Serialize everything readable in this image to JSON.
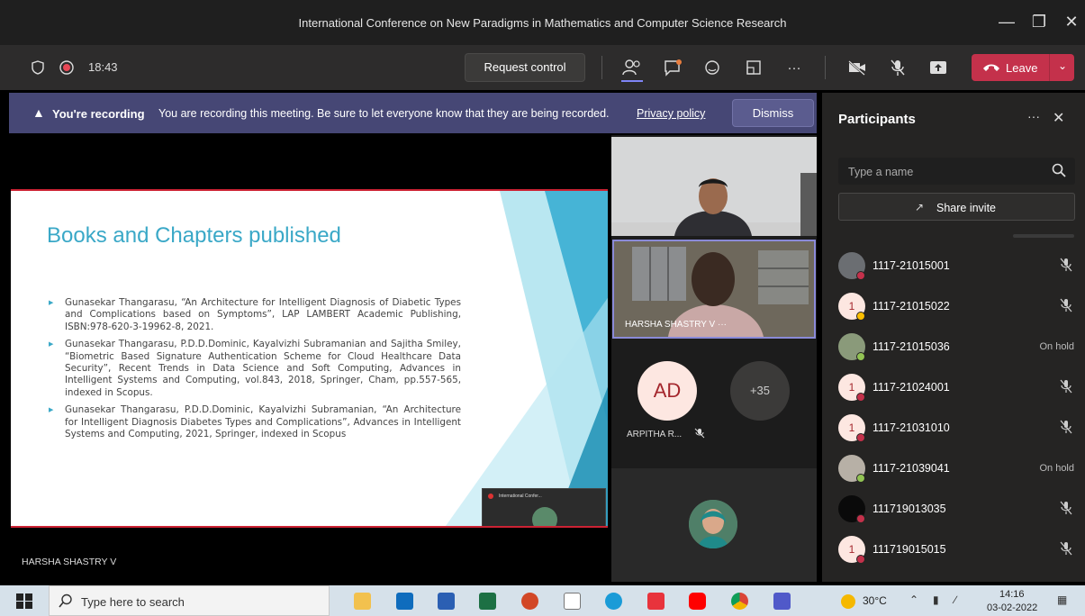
{
  "window": {
    "title": "International Conference on New Paradigms in Mathematics and Computer Science Research",
    "minimize": "—",
    "maximize": "❐",
    "close": "✕"
  },
  "toolbar": {
    "timer": "18:43",
    "request_control": "Request control",
    "more": "···",
    "leave": "Leave",
    "icons": [
      "shield-icon",
      "record-icon",
      "people-icon",
      "chat-icon",
      "reactions-icon",
      "rooms-icon",
      "more-icon",
      "camera-off-icon",
      "mic-off-icon",
      "share-icon",
      "phone-icon"
    ]
  },
  "banner": {
    "title": "You're recording",
    "text": "You are recording this meeting. Be sure to let everyone know that they are being recorded.",
    "link": "Privacy policy",
    "dismiss": "Dismiss"
  },
  "slide": {
    "title": "Books and Chapters published",
    "items": [
      "Gunasekar Thangarasu, “An Architecture for Intelligent Diagnosis of Diabetic Types and Complications based on Symptoms”, LAP LAMBERT Academic Publishing, ISBN:978-620-3-19962-8, 2021.",
      "Gunasekar Thangarasu, P.D.D.Dominic, Kayalvizhi Subramanian and Sajitha Smiley, “Biometric Based Signature Authentication Scheme for Cloud Healthcare Data Security”, Recent Trends in Data Science and Soft Computing, Advances in Intelligent Systems and Computing, vol.843, 2018, Springer, Cham, pp.557-565, indexed in Scopus.",
      "Gunasekar Thangarasu, P.D.D.Dominic, Kayalvizhi Subramanian, “An Architecture for Intelligent Diagnosis Diabetes Types and Complications”, Advances in Intelligent Systems and Computing, 2021, Springer, indexed in Scopus"
    ],
    "mini_window_title": "International Confer...",
    "presenter": "HARSHA SHASTRY V"
  },
  "videos": {
    "tile2_name": "HARSHA SHASTRY V",
    "tile2_more": "···",
    "avatar_initials": "AD",
    "avatar_name": "ARPITHA R...",
    "overflow_count": "+35"
  },
  "participants": {
    "title": "Participants",
    "more": "···",
    "close": "✕",
    "search_placeholder": "Type a name",
    "share_invite": "Share invite",
    "list": [
      {
        "name": "1117-21015001",
        "status": "",
        "muted": true,
        "avatar": "photo",
        "initial": ""
      },
      {
        "name": "1117-21015022",
        "status": "",
        "muted": true,
        "avatar": "initial",
        "initial": "1"
      },
      {
        "name": "1117-21015036",
        "status": "On hold",
        "muted": false,
        "avatar": "photo",
        "initial": ""
      },
      {
        "name": "1117-21024001",
        "status": "",
        "muted": true,
        "avatar": "initial",
        "initial": "1"
      },
      {
        "name": "1117-21031010",
        "status": "",
        "muted": true,
        "avatar": "initial",
        "initial": "1"
      },
      {
        "name": "1117-21039041",
        "status": "On hold",
        "muted": false,
        "avatar": "photo",
        "initial": ""
      },
      {
        "name": "111719013035",
        "status": "",
        "muted": true,
        "avatar": "dark",
        "initial": ""
      },
      {
        "name": "111719015015",
        "status": "",
        "muted": true,
        "avatar": "initial",
        "initial": "1"
      }
    ]
  },
  "taskbar": {
    "search_placeholder": "Type here to search",
    "temperature": "30°C",
    "time": "14:16",
    "date": "03-02-2022",
    "apps": [
      "file-explorer-icon",
      "outlook-icon",
      "word-icon",
      "excel-icon",
      "powerpoint-icon",
      "wordpad-icon",
      "edge-icon",
      "news-icon",
      "youtube-icon",
      "chrome-icon",
      "teams-icon"
    ]
  },
  "colors": {
    "banner": "#464775",
    "leave": "#c4314b",
    "slide_title": "#3aa8c7",
    "panel": "#252423"
  }
}
